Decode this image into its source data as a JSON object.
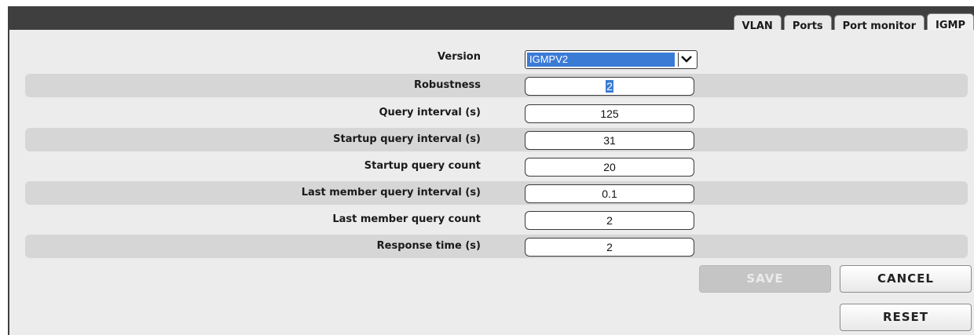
{
  "tabs": [
    {
      "label": "VLAN"
    },
    {
      "label": "Ports"
    },
    {
      "label": "Port monitor"
    },
    {
      "label": "IGMP"
    }
  ],
  "active_tab": "IGMP",
  "form": {
    "version": {
      "label": "Version",
      "value": "IGMPV2"
    },
    "robustness": {
      "label": "Robustness",
      "value": "2"
    },
    "query_interval": {
      "label": "Query interval (s)",
      "value": "125"
    },
    "startup_query_interval": {
      "label": "Startup query interval (s)",
      "value": "31"
    },
    "startup_query_count": {
      "label": "Startup query count",
      "value": "20"
    },
    "last_member_query_interval": {
      "label": "Last member query interval (s)",
      "value": "0.1"
    },
    "last_member_query_count": {
      "label": "Last member query count",
      "value": "2"
    },
    "response_time": {
      "label": "Response time (s)",
      "value": "2"
    }
  },
  "buttons": {
    "save": "SAVE",
    "cancel": "CANCEL",
    "reset": "RESET"
  },
  "colors": {
    "header_dark": "#3f3f3f",
    "panel_bg": "#ececec",
    "row_shade": "#d6d6d6",
    "selection_blue": "#3a7bd5"
  },
  "icons": {
    "select_arrow": "chevron-down-icon"
  }
}
